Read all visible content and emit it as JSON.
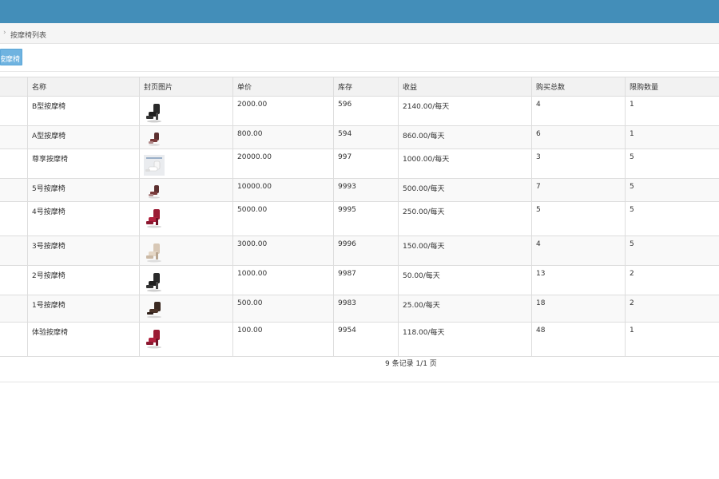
{
  "breadcrumb": {
    "separator": "›",
    "current": "按摩椅列表"
  },
  "toolbar": {
    "add_label": "添加按摩椅"
  },
  "table": {
    "headers": [
      "名称",
      "封页图片",
      "单价",
      "库存",
      "收益",
      "购买总数",
      "限购数量"
    ],
    "rows": [
      {
        "name": "B型按摩椅",
        "image": "black-chair",
        "price": "2000.00",
        "stock": "596",
        "income": "2140.00/每天",
        "total": "4",
        "limit": "1"
      },
      {
        "name": "A型按摩椅",
        "image": "brown-chair-small",
        "price": "800.00",
        "stock": "594",
        "income": "860.00/每天",
        "total": "6",
        "limit": "1"
      },
      {
        "name": "尊享按摩椅",
        "image": "white-chair-photo",
        "price": "20000.00",
        "stock": "997",
        "income": "1000.00/每天",
        "total": "3",
        "limit": "5"
      },
      {
        "name": "5号按摩椅",
        "image": "brown-chair-small",
        "price": "10000.00",
        "stock": "9993",
        "income": "500.00/每天",
        "total": "7",
        "limit": "5"
      },
      {
        "name": "4号按摩椅",
        "image": "red-chair",
        "price": "5000.00",
        "stock": "9995",
        "income": "250.00/每天",
        "total": "5",
        "limit": "5"
      },
      {
        "name": "3号按摩椅",
        "image": "beige-chair",
        "price": "3000.00",
        "stock": "9996",
        "income": "150.00/每天",
        "total": "4",
        "limit": "5"
      },
      {
        "name": "2号按摩椅",
        "image": "black-chair",
        "price": "1000.00",
        "stock": "9987",
        "income": "50.00/每天",
        "total": "13",
        "limit": "2"
      },
      {
        "name": "1号按摩椅",
        "image": "dark-brown-chair",
        "price": "500.00",
        "stock": "9983",
        "income": "25.00/每天",
        "total": "18",
        "limit": "2"
      },
      {
        "name": "体验按摩椅",
        "image": "red-chair",
        "price": "100.00",
        "stock": "9954",
        "income": "118.00/每天",
        "total": "48",
        "limit": "1"
      }
    ]
  },
  "pager": {
    "summary": "9 条记录 1/1 页"
  },
  "colors": {
    "topbar": "#438eb9",
    "button": "#6fb3e0"
  }
}
